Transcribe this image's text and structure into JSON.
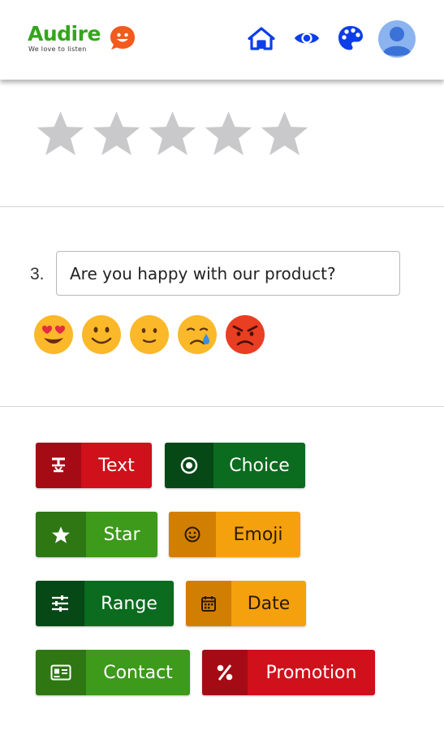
{
  "header": {
    "logo_text": "Audire",
    "logo_tagline": "We love to listen",
    "nav": [
      {
        "icon": "home-icon"
      },
      {
        "icon": "eye-icon"
      },
      {
        "icon": "palette-icon"
      },
      {
        "icon": "user-avatar-icon"
      }
    ]
  },
  "rating": {
    "max_stars": 5,
    "selected": 0,
    "star_color": "#c9c9cc"
  },
  "question": {
    "number": "3.",
    "text": "Are you happy with our product?"
  },
  "emojis": [
    "heart-eyes-emoji-icon",
    "smiling-emoji-icon",
    "slight-smile-emoji-icon",
    "crying-emoji-icon",
    "angry-emoji-icon"
  ],
  "question_types": [
    {
      "label": "Text",
      "icon": "text-format-icon",
      "color": "#d0101b"
    },
    {
      "label": "Choice",
      "icon": "radio-choice-icon",
      "color": "#0b6b1f"
    },
    {
      "label": "Star",
      "icon": "star-icon",
      "color": "#3d9a1b"
    },
    {
      "label": "Emoji",
      "icon": "smiley-icon",
      "color": "#f5a10e"
    },
    {
      "label": "Range",
      "icon": "sliders-icon",
      "color": "#0b6b1f"
    },
    {
      "label": "Date",
      "icon": "calendar-icon",
      "color": "#f5a10e"
    },
    {
      "label": "Contact",
      "icon": "contact-card-icon",
      "color": "#3d9a1b"
    },
    {
      "label": "Promotion",
      "icon": "percent-icon",
      "color": "#d0101b"
    }
  ]
}
